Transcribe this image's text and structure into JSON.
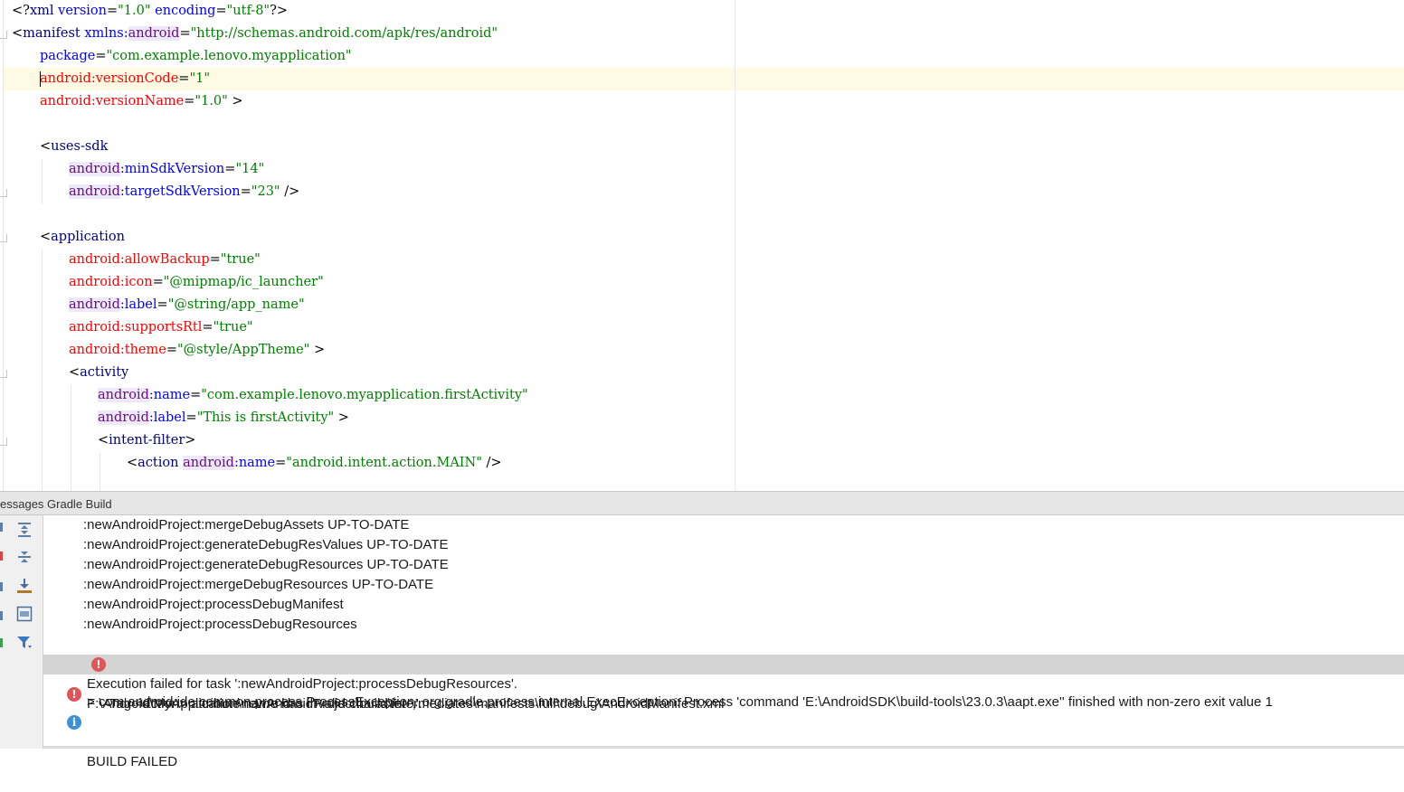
{
  "editor": {
    "lines": {
      "l1": {
        "a": "<?",
        "b": "xml",
        "c": " ",
        "d": "version",
        "e": "=",
        "f": "\"1.0\"",
        "g": " ",
        "h": "encoding",
        "i": "=",
        "j": "\"utf-8\"",
        "k": "?>"
      },
      "l2": {
        "a": "<",
        "b": "manifest",
        "c": " ",
        "d": "xmlns:",
        "e": "android",
        "f": "=",
        "g": "\"http://schemas.android.com/apk/res/android\""
      },
      "l3": {
        "a": "package",
        "b": "=",
        "c": "\"com.example.lenovo.myapplication\""
      },
      "l4": {
        "a": "android",
        "b": ":versionCode",
        "c": "=",
        "d": "\"1\""
      },
      "l5": {
        "a": "android",
        "b": ":versionName",
        "c": "=",
        "d": "\"1.0\"",
        "e": " >"
      },
      "l7": {
        "a": "<",
        "b": "uses-sdk"
      },
      "l8": {
        "a": "android",
        "b": ":minSdkVersion",
        "c": "=",
        "d": "\"14\""
      },
      "l9": {
        "a": "android",
        "b": ":targetSdkVersion",
        "c": "=",
        "d": "\"23\"",
        "e": " />"
      },
      "l11": {
        "a": "<",
        "b": "application"
      },
      "l12": {
        "a": "android",
        "b": ":allowBackup",
        "c": "=",
        "d": "\"true\""
      },
      "l13": {
        "a": "android",
        "b": ":icon",
        "c": "=",
        "d": "\"@mipmap/ic_launcher\""
      },
      "l14": {
        "a": "android",
        "b": ":label",
        "c": "=",
        "d": "\"@string/app_name\""
      },
      "l15": {
        "a": "android",
        "b": ":supportsRtl",
        "c": "=",
        "d": "\"true\""
      },
      "l16": {
        "a": "android",
        "b": ":theme",
        "c": "=",
        "d": "\"@style/AppTheme\"",
        "e": " >"
      },
      "l17": {
        "a": "<",
        "b": "activity"
      },
      "l18": {
        "a": "android",
        "b": ":name",
        "c": "=",
        "d": "\"com.example.lenovo.myapplication.firstActivity\""
      },
      "l19": {
        "a": "android",
        "b": ":label",
        "c": "=",
        "d": "\"This is firstActivity\"",
        "e": " >"
      },
      "l20": {
        "a": "<",
        "b": "intent-filter",
        "c": ">"
      },
      "l21": {
        "a": "<",
        "b": "action",
        "c": " ",
        "d": "android",
        "e": ":name",
        "f": "=",
        "g": "\"android.intent.action.MAIN\"",
        "h": " />"
      }
    }
  },
  "tool_window": {
    "title": "essages Gradle Build",
    "messages": [
      ":newAndroidProject:mergeDebugAssets UP-TO-DATE",
      ":newAndroidProject:generateDebugResValues UP-TO-DATE",
      ":newAndroidProject:generateDebugResources UP-TO-DATE",
      ":newAndroidProject:mergeDebugResources UP-TO-DATE",
      ":newAndroidProject:processDebugManifest",
      ":newAndroidProject:processDebugResources"
    ],
    "file_path": "F:\\Android\\MyApplication\\newAndroidProject\\build\\intermediates\\manifests\\full\\debug\\AndroidManifest.xml",
    "error_tag": "Tag <action> attribute name has invalid character ','.",
    "error_exec_line1": "Execution failed for task ':newAndroidProject:processDebugResources'.",
    "error_exec_line2": "> com.android.ide.common.process.ProcessException: org.gradle.process.internal.ExecException: Process 'command 'E:\\AndroidSDK\\build-tools\\23.0.3\\aapt.exe'' finished with non-zero exit value 1",
    "build_failed": "BUILD FAILED",
    "error_glyph": "!",
    "info_glyph": "i"
  },
  "colors": {
    "tag": "#000080",
    "namespace": "#660e7a",
    "attribute": "#0000ff",
    "attribute_error": "#ff0000",
    "string_value": "#008000",
    "caret_line": "#fffae3",
    "error_icon": "#e05555",
    "info_icon": "#3d8fd8",
    "selected_row": "#d4d4d4"
  },
  "icons": {
    "toolbar": [
      "expand-all-icon",
      "collapse-all-icon",
      "export-icon",
      "autoscroll-icon",
      "filter-icon"
    ],
    "tree": [
      "expand-arrow-icon",
      "xml-file-icon",
      "error-icon",
      "info-icon"
    ]
  }
}
